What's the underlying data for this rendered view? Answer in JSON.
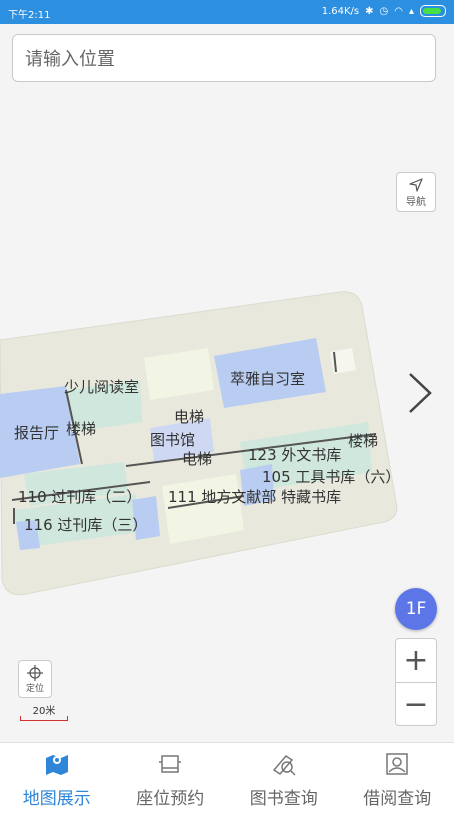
{
  "status_bar": {
    "time": "下午2:11",
    "network_speed": "1.64K/s",
    "icons": [
      "bluetooth-icon",
      "alarm-icon",
      "wifi-icon",
      "signal-icon",
      "battery-icon"
    ]
  },
  "search": {
    "placeholder": "请输入位置"
  },
  "map": {
    "navigate_label": "导航",
    "floor": "1F",
    "zoom_in": "+",
    "zoom_out": "−",
    "locate_label": "定位",
    "scale_label": "20米",
    "rooms": {
      "children_reading": "少儿阅读室",
      "study_room": "萃雅自习室",
      "lecture_hall": "报告厅",
      "stairs_left": "楼梯",
      "elevator_1": "电梯",
      "library": "图书馆",
      "elevator_2": "电梯",
      "foreign_books": "123 外文书库",
      "stairs_right": "楼梯",
      "tool_books": "105 工具书库（六）",
      "periodicals_2": "110 过刊库（二）",
      "local_docs": "111 地方文献部 特藏书库",
      "periodicals_3": "116 过刊库（三）"
    }
  },
  "tabs": [
    {
      "label": "地图展示",
      "icon": "map-icon",
      "active": true
    },
    {
      "label": "座位预约",
      "icon": "seat-icon",
      "active": false
    },
    {
      "label": "图书查询",
      "icon": "book-search-icon",
      "active": false
    },
    {
      "label": "借阅查询",
      "icon": "borrow-search-icon",
      "active": false
    }
  ],
  "colors": {
    "accent": "#2f86d8",
    "floor_button": "#5c76e8",
    "status_bar": "#2d8fe0"
  }
}
